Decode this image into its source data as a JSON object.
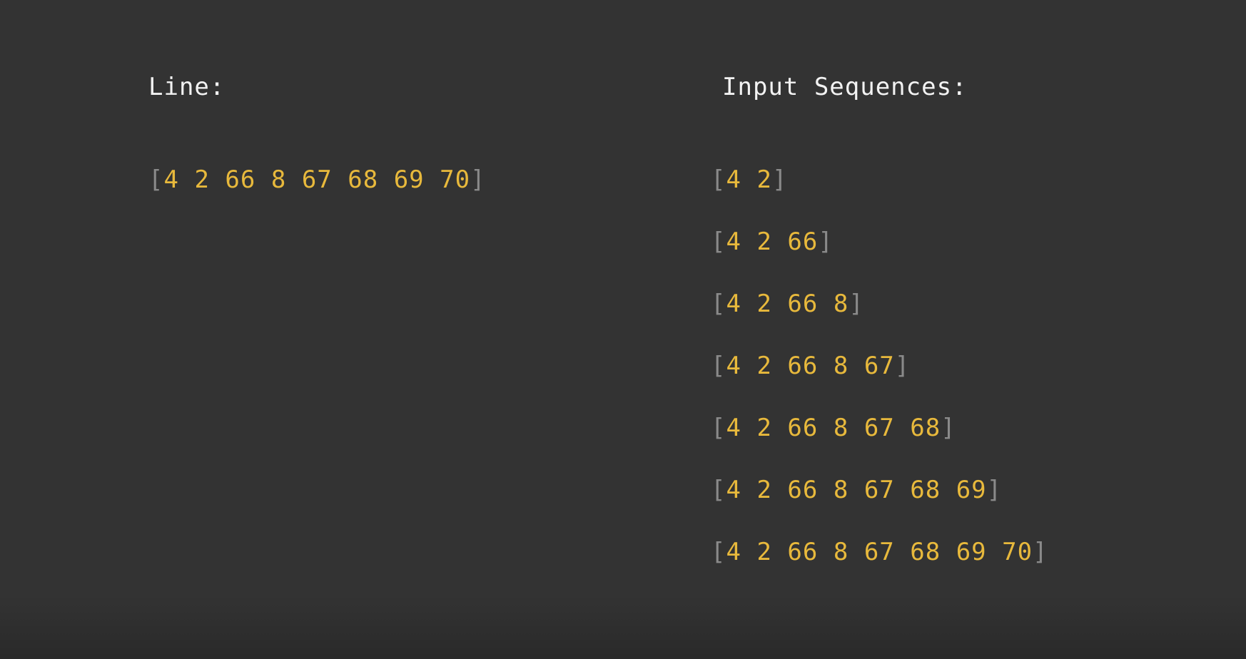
{
  "line": {
    "heading": "Line:",
    "tokens": [
      "4",
      "2",
      "66",
      "8",
      "67",
      "68",
      "69",
      "70"
    ]
  },
  "input_sequences": {
    "heading": "Input Sequences:",
    "items": [
      [
        "4",
        "2"
      ],
      [
        "4",
        "2",
        "66"
      ],
      [
        "4",
        "2",
        "66",
        "8"
      ],
      [
        "4",
        "2",
        "66",
        "8",
        "67"
      ],
      [
        "4",
        "2",
        "66",
        "8",
        "67",
        "68"
      ],
      [
        "4",
        "2",
        "66",
        "8",
        "67",
        "68",
        "69"
      ],
      [
        "4",
        "2",
        "66",
        "8",
        "67",
        "68",
        "69",
        "70"
      ]
    ]
  },
  "colors": {
    "background": "#333333",
    "heading": "#f2f2f2",
    "token": "#e8b93c",
    "bracket": "#8a8a8a"
  }
}
